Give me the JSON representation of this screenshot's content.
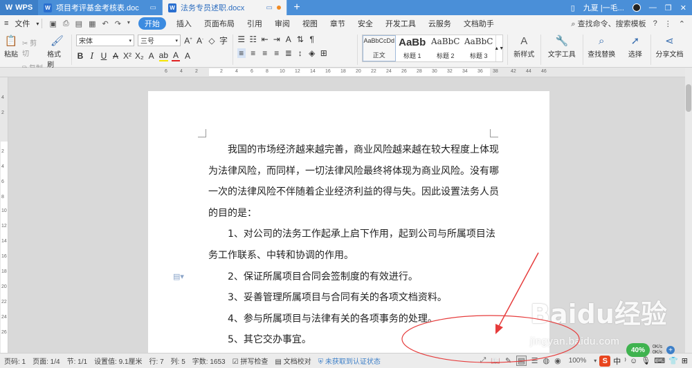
{
  "titlebar": {
    "app_name": "WPS",
    "tabs": [
      {
        "label": "项目考评基金考核表.doc"
      },
      {
        "label": "法务专员述职.docx"
      }
    ],
    "user_name": "九夏 |一毛..."
  },
  "menubar": {
    "file_label": "文件",
    "items": [
      "开始",
      "插入",
      "页面布局",
      "引用",
      "审阅",
      "视图",
      "章节",
      "安全",
      "开发工具",
      "云服务",
      "文档助手"
    ],
    "search_placeholder": "查找命令、搜索模板"
  },
  "ribbon": {
    "paste_label": "粘贴",
    "cut_label": "剪切",
    "copy_label": "复制",
    "format_painter_label": "格式刷",
    "font_name": "宋体",
    "font_size": "三号",
    "styles": [
      {
        "sample": "AaBbCcDd",
        "label": "正文"
      },
      {
        "sample": "AaBb",
        "label": "标题 1"
      },
      {
        "sample": "AaBbC",
        "label": "标题 2"
      },
      {
        "sample": "AaBbC",
        "label": "标题 3"
      }
    ],
    "new_style_label": "新样式",
    "text_tools_label": "文字工具",
    "find_replace_label": "查找替换",
    "select_label": "选择",
    "share_label": "分享文档"
  },
  "document": {
    "paragraphs": [
      "我国的市场经济越来越完善，商业风险越来越在较大程度上体现为法律风险，而同样，一切法律风险最终将体现为商业风险。没有哪一次的法律风险不伴随着企业经济利益的得与失。因此设置法务人员的目的是：",
      "1、对公司的法务工作起承上启下作用，起到公司与所属项目法务工作联系、中转和协调的作用。",
      "2、保证所属项目合同会签制度的有效进行。",
      "3、妥善管理所属项目与合同有关的各项文档资料。",
      "4、参与所属项目与法律有关的各项事务的处理。",
      "5、其它交办事宜。"
    ]
  },
  "statusbar": {
    "page_code": "页码: 1",
    "pages": "页面: 1/4",
    "section": "节: 1/1",
    "position": "设置值: 9.1厘米",
    "row": "行: 7",
    "col": "列: 5",
    "word_count": "字数: 1653",
    "spellcheck": "拼写检查",
    "doc_check": "文档校对",
    "cert_status": "未获取到认证状态",
    "zoom": "100%"
  },
  "network": {
    "percent": "40%",
    "up": "0K/s",
    "down": "0K/s"
  },
  "ime": {
    "mode": "中"
  },
  "watermark": {
    "brand": "Baidu经验",
    "url": "jingyan.baidu.com"
  },
  "colors": {
    "titlebar": "#4a8fd8",
    "accent": "#3c8be0",
    "annotation": "#e63b3b"
  }
}
